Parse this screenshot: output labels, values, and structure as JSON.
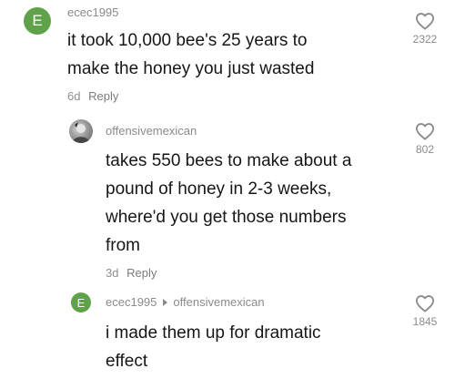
{
  "comments": [
    {
      "avatar_letter": "E",
      "username": "ecec1995",
      "lines": [
        "it took 10,000 bee's 25 years to",
        "make the honey you just wasted"
      ],
      "time": "6d",
      "reply_label": "Reply",
      "likes": "2322"
    },
    {
      "username": "offensivemexican",
      "lines": [
        "takes 550 bees to make about a",
        "pound of honey in 2-3 weeks,",
        "where'd you get those numbers",
        "from"
      ],
      "time": "3d",
      "reply_label": "Reply",
      "likes": "802"
    },
    {
      "avatar_letter": "E",
      "username": "ecec1995",
      "reply_to": "offensivemexican",
      "lines": [
        "i made them up for dramatic",
        "effect"
      ],
      "likes": "1845"
    }
  ],
  "icons": {
    "like": "heart-outline-icon",
    "reply_arrow": "triangle-right-icon"
  },
  "colors": {
    "avatar_green": "#5fa24a",
    "secondary_text": "#8a8a8a"
  }
}
